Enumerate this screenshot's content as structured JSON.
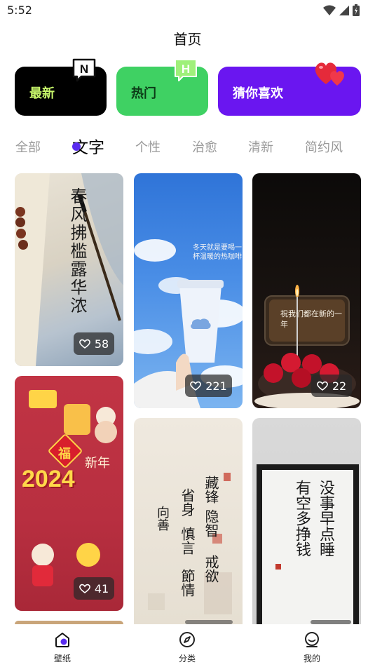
{
  "status": {
    "time": "5:52"
  },
  "header": {
    "title": "首页"
  },
  "features": {
    "newest": {
      "label": "最新",
      "badge": "N"
    },
    "hot": {
      "label": "热门",
      "badge": "H"
    },
    "guess": {
      "label": "猜你喜欢"
    }
  },
  "tabs": [
    "全部",
    "文字",
    "个性",
    "治愈",
    "清新",
    "简约风"
  ],
  "active_tab": "文字",
  "wallpapers": [
    {
      "likes": "58",
      "text": "春风拂槛露华浓"
    },
    {
      "likes": "221",
      "text": "冬天就是要喝一杯温暖的热咖啡"
    },
    {
      "likes": "22",
      "text": "祝我们都在新的一年"
    },
    {
      "likes": "41",
      "text": "2024"
    },
    {
      "likes": "",
      "text": "藏锋隐智 戒欲 省身慎言 节情 向善"
    },
    {
      "likes": "",
      "text": "没事早点睡 有空多挣钱"
    }
  ],
  "tile_texts": {
    "poster_2024": "2024",
    "poster_new_year": "新年",
    "poster_fu": "福",
    "calligraphy_a1": "藏锋",
    "calligraphy_a2": "隐智",
    "calligraphy_a3": "戒欲",
    "calligraphy_b1": "省身",
    "calligraphy_b2": "慎言",
    "calligraphy_b3": "節情",
    "calligraphy_c": "向善",
    "frame_col1": "没事早点睡",
    "frame_col2": "有空多挣钱"
  },
  "nav": {
    "wallpaper": "壁纸",
    "category": "分类",
    "mine": "我的"
  },
  "colors": {
    "accent": "#5a2cf0",
    "newest_bg": "#000000",
    "hot_bg": "#3fd163",
    "guess_bg": "#6a16f0"
  }
}
